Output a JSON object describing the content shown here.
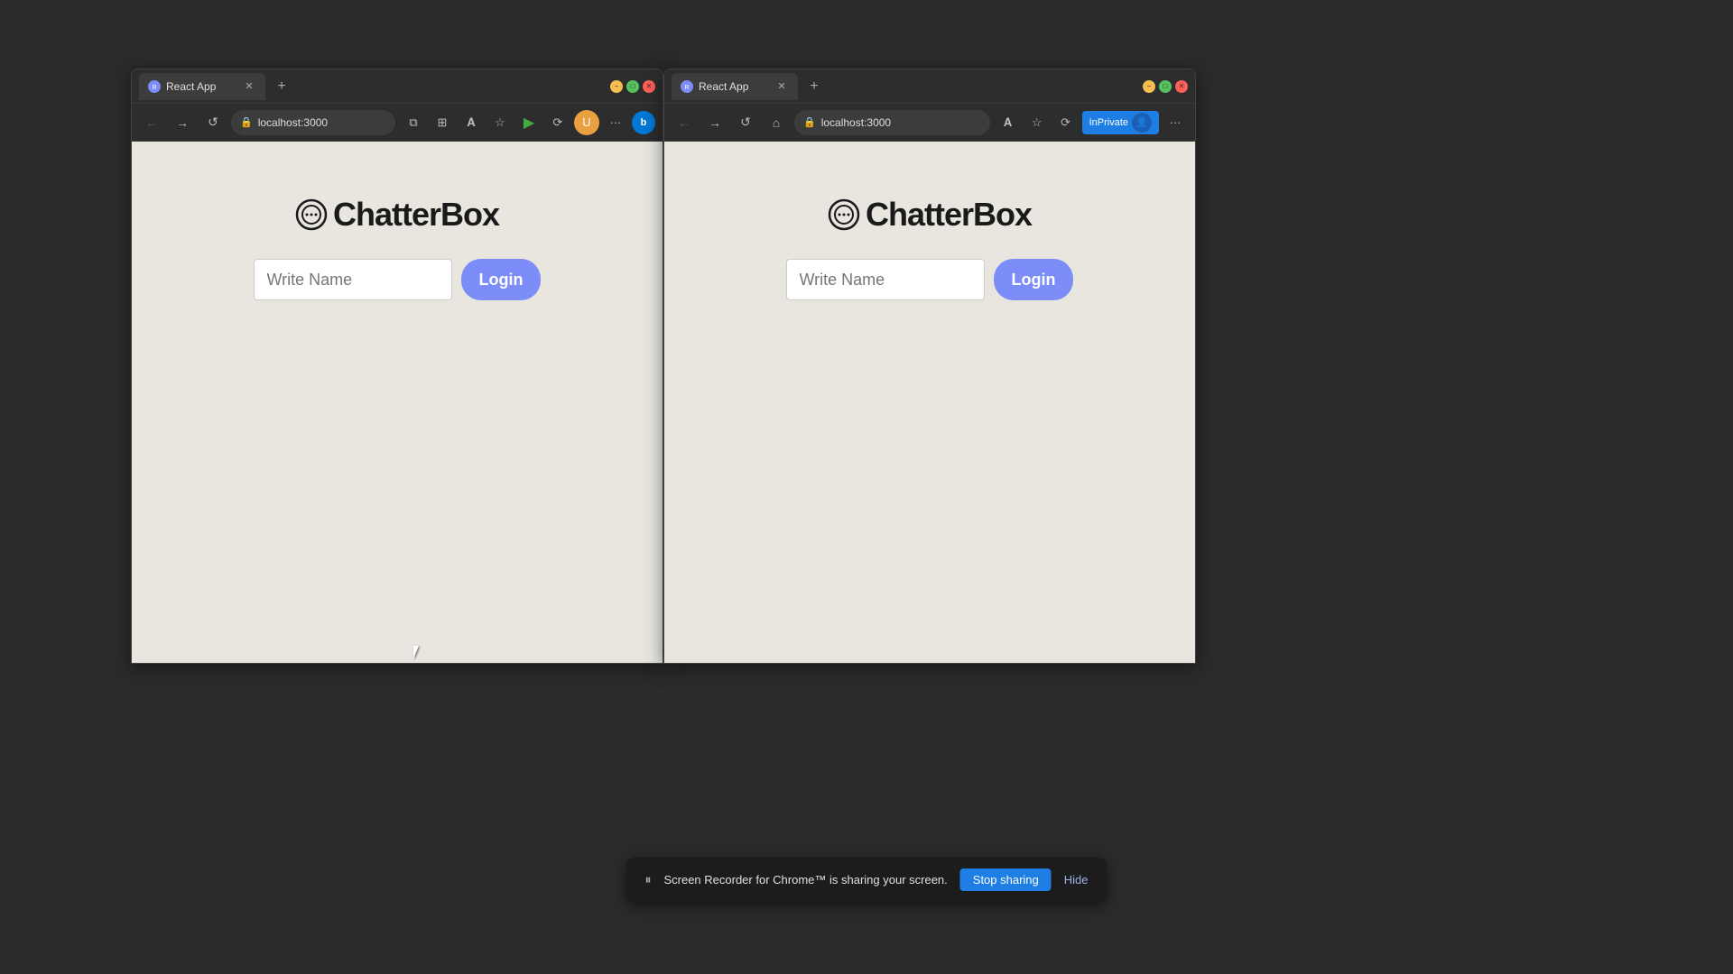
{
  "left_browser": {
    "tab_label": "React App",
    "url": "localhost:3000",
    "app_title": "ChatterBox",
    "input_placeholder": "Write Name",
    "login_button": "Login"
  },
  "right_browser": {
    "tab_label": "React App",
    "url": "localhost:3000",
    "app_title": "ChatterBox",
    "input_placeholder": "Write Name",
    "login_button": "Login",
    "inprivate_label": "InPrivate"
  },
  "screen_share_bar": {
    "message": "Screen Recorder for Chrome™ is sharing your screen.",
    "stop_button": "Stop sharing",
    "hide_button": "Hide"
  },
  "nav": {
    "back": "←",
    "forward": "→",
    "refresh": "↺",
    "home": "⌂",
    "more": "···"
  }
}
